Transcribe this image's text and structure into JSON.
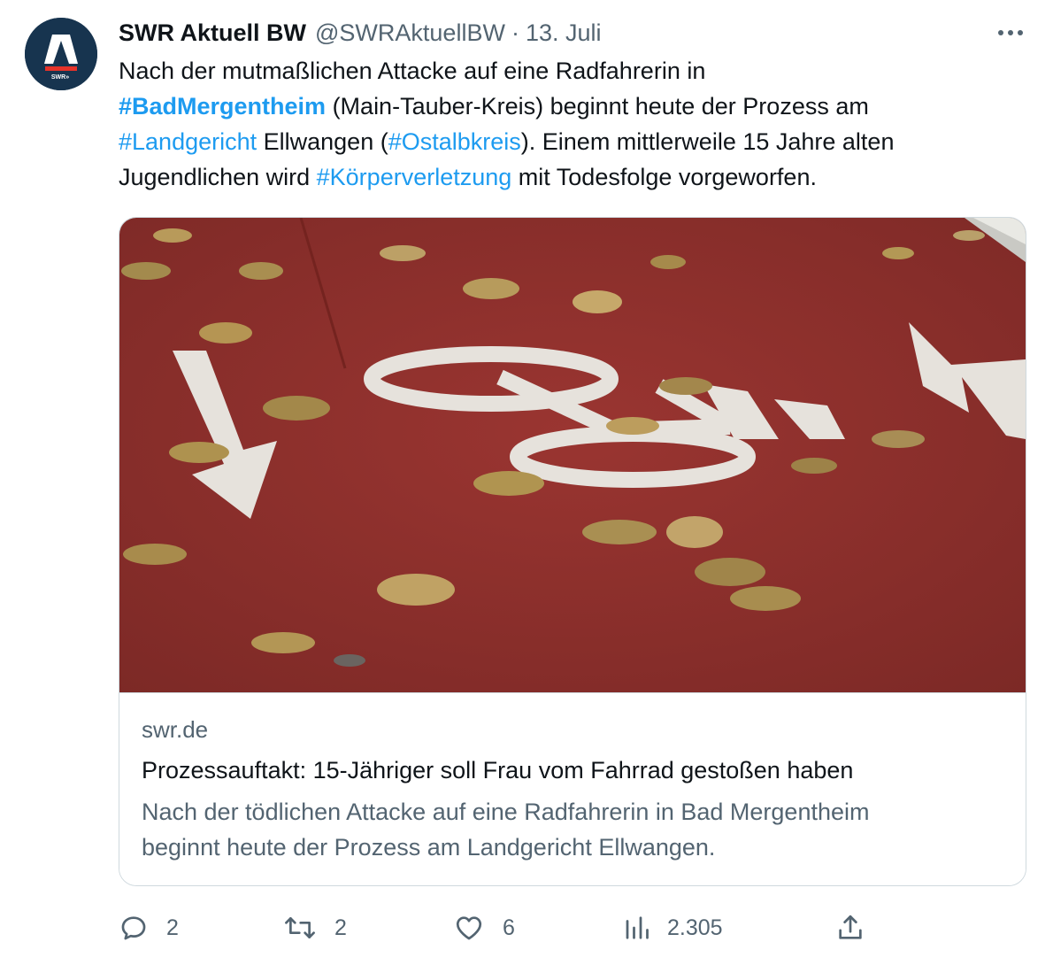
{
  "author": {
    "name": "SWR Aktuell BW",
    "handle": "@SWRAktuellBW",
    "separator": "·",
    "date": "13. Juli",
    "avatar_logo_text": "SWR»"
  },
  "tweet": {
    "segments": [
      {
        "text": "Nach der mutmaßlichen Attacke auf eine Radfahrerin in"
      },
      {
        "text": "#BadMergentheim"
      },
      {
        "text": " (Main-Tauber-Kreis) beginnt heute der Prozess am"
      },
      {
        "text": "#Landgericht"
      },
      {
        "text": " Ellwangen ("
      },
      {
        "text": "#Ostalbkreis"
      },
      {
        "text": "). Einem mittlerweile 15 Jahre alten"
      },
      {
        "text": "Jugendlichen wird "
      },
      {
        "text": "#Körperverletzung"
      },
      {
        "text": " mit Todesfolge vorgeworfen."
      }
    ]
  },
  "card": {
    "image_alt": "Roter Radweg mit weißem Fahrradsymbol, Pfeilen und Herbstlaub",
    "domain": "swr.de",
    "title": "Prozessauftakt: 15-Jähriger soll Frau vom Fahrrad gestoßen haben",
    "description_lines": [
      "Nach der tödlichen Attacke auf eine Radfahrerin in Bad Mergentheim",
      "beginnt heute der Prozess am Landgericht Ellwangen."
    ]
  },
  "actions": {
    "replies": "2",
    "retweets": "2",
    "likes": "6",
    "views": "2.305"
  },
  "colors": {
    "link": "#1d9bf0",
    "text": "#0f1419",
    "secondary": "#536471",
    "border": "#cfd9de",
    "road": "#8f2f2c",
    "avatar_bg": "#17344f",
    "logo_red": "#e6332a"
  },
  "icons": {
    "more": "more-horizontal-icon",
    "reply": "reply-icon",
    "retweet": "retweet-icon",
    "like": "heart-icon",
    "views": "analytics-icon",
    "share": "share-icon"
  }
}
